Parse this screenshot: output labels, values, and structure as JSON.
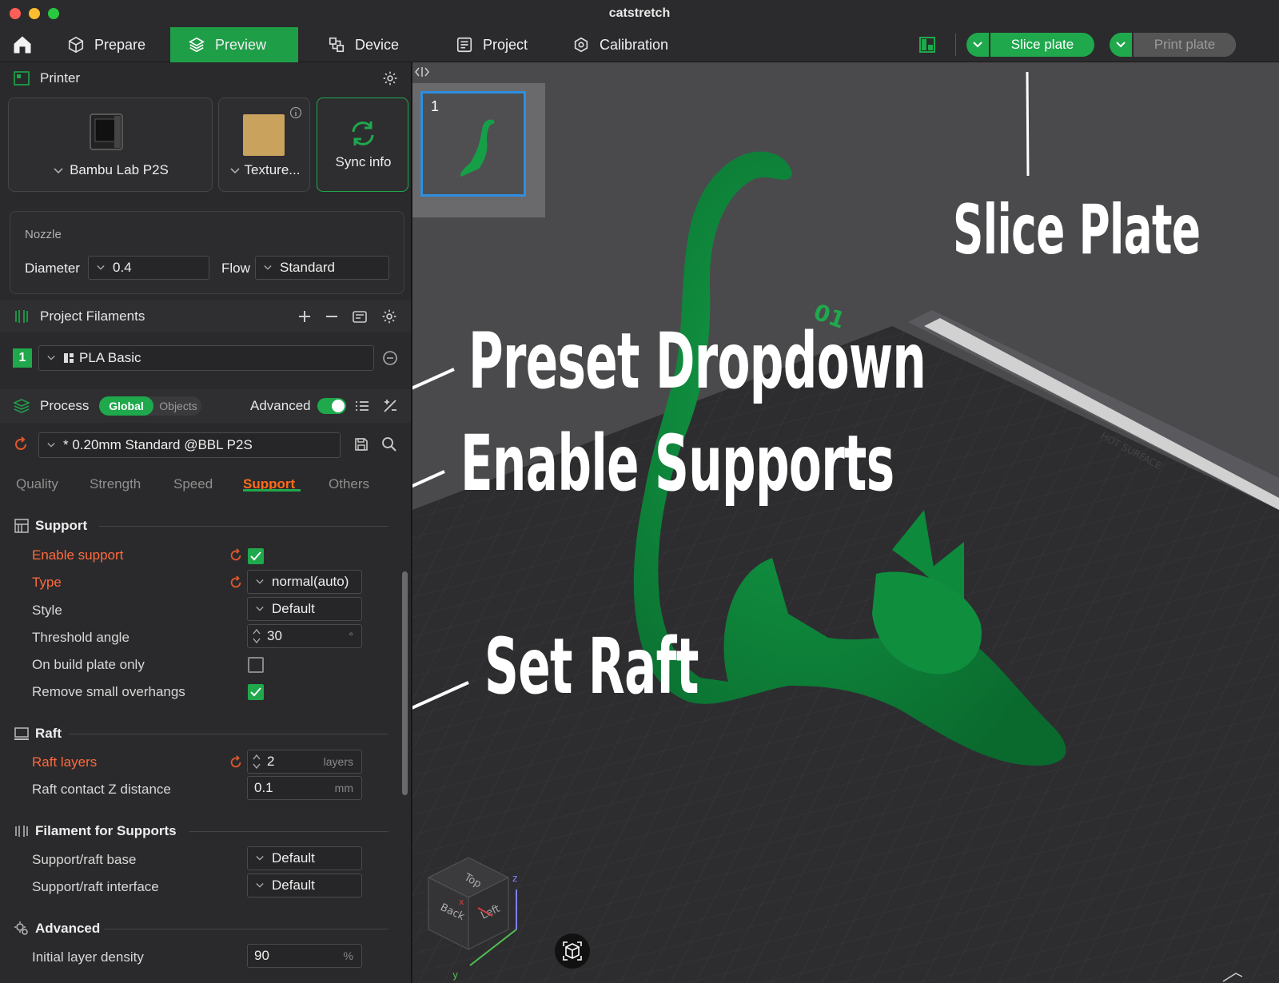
{
  "window": {
    "title": "catstretch"
  },
  "toolbar": {
    "tabs": [
      {
        "label": "Prepare",
        "icon": "cube-icon"
      },
      {
        "label": "Preview",
        "icon": "layers-icon"
      },
      {
        "label": "Device",
        "icon": "device-icon"
      },
      {
        "label": "Project",
        "icon": "project-icon"
      },
      {
        "label": "Calibration",
        "icon": "calibration-icon"
      }
    ],
    "active_tab": "Preview",
    "slice_label": "Slice plate",
    "print_label": "Print plate",
    "accent": "#1fa84c"
  },
  "printer": {
    "header": "Printer",
    "printer_name": "Bambu Lab P2S",
    "plate_name": "Texture...",
    "sync_label": "Sync info"
  },
  "nozzle": {
    "label": "Nozzle",
    "diameter_label": "Diameter",
    "diameter_value": "0.4",
    "flow_label": "Flow",
    "flow_value": "Standard"
  },
  "filaments": {
    "header": "Project Filaments",
    "items": [
      {
        "index": "1",
        "name": "PLA Basic",
        "color": "#1fa84c"
      }
    ]
  },
  "process": {
    "header": "Process",
    "global_label": "Global",
    "objects_label": "Objects",
    "advanced_label": "Advanced",
    "advanced_on": true,
    "preset": "* 0.20mm Standard @BBL P2S",
    "tabs": [
      "Quality",
      "Strength",
      "Speed",
      "Support",
      "Others"
    ],
    "active_tab": "Support"
  },
  "support": {
    "title": "Support",
    "enable_label": "Enable support",
    "enable_checked": true,
    "type_label": "Type",
    "type_value": "normal(auto)",
    "style_label": "Style",
    "style_value": "Default",
    "threshold_label": "Threshold angle",
    "threshold_value": "30",
    "threshold_unit": "°",
    "build_plate_label": "On build plate only",
    "build_plate_checked": false,
    "remove_label": "Remove small overhangs",
    "remove_checked": true
  },
  "raft": {
    "title": "Raft",
    "layers_label": "Raft layers",
    "layers_value": "2",
    "layers_unit": "layers",
    "contact_label": "Raft contact Z distance",
    "contact_value": "0.1",
    "contact_unit": "mm"
  },
  "filament_supports": {
    "title": "Filament for Supports",
    "base_label": "Support/raft base",
    "base_value": "Default",
    "interface_label": "Support/raft interface",
    "interface_value": "Default"
  },
  "advanced": {
    "title": "Advanced",
    "density_label": "Initial layer density",
    "density_value": "90",
    "density_unit": "%"
  },
  "viewport": {
    "plate_number": "1",
    "plate_label": "01",
    "bed_text": "HOT SURFACE",
    "cube_top": "Top",
    "cube_back": "Back",
    "cube_left": "Left",
    "axis_z": "z",
    "axis_y": "y",
    "axis_x": "x",
    "model_color": "#0d7a36"
  },
  "annotations": {
    "slice_plate": "Slice Plate",
    "preset_dropdown": "Preset Dropdown",
    "enable_supports": "Enable Supports",
    "set_raft": "Set Raft"
  }
}
